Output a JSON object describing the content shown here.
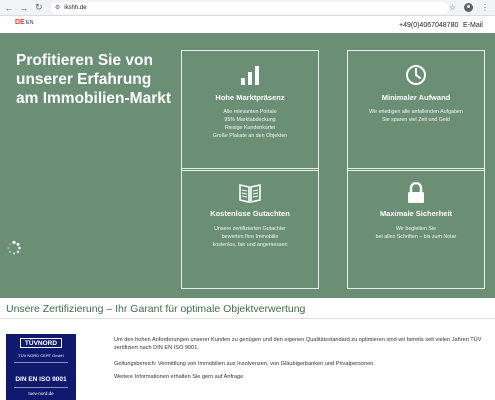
{
  "browser": {
    "url": "ikshh.de"
  },
  "topbar": {
    "lang_de": "DE",
    "lang_en": "EN",
    "phone": "+49(0)4067048780",
    "email": "E-Mail"
  },
  "hero": {
    "title": "Profitieren Sie von unserer Erfahrung am Immobilien-Markt",
    "background_color": "#6b8f75",
    "features": [
      {
        "icon": "bar-chart-icon",
        "title": "Hohe Marktpräsenz",
        "lines": [
          "Alle relevanten Portale",
          "95% Marktabdeckung",
          "Riesige Kundenkartei",
          "Große Plakate an den Objekten"
        ]
      },
      {
        "icon": "clock-icon",
        "title": "Minimaler Aufwand",
        "lines": [
          "Wir erledigen alle anfallenden Aufgaben",
          "Sie sparen viel Zeit und Geld"
        ]
      },
      {
        "icon": "book-icon",
        "title": "Kostenlose Gutachten",
        "lines": [
          "Unsere zertifizierten Gutachter",
          "bewerten Ihre Immobilie",
          "kostenlos, fair und angemessen"
        ]
      },
      {
        "icon": "lock-icon",
        "title": "Maximale Sicherheit",
        "lines": [
          "Wir begleiten Sie",
          "bei allen Schritten – bis zum Notar"
        ]
      }
    ]
  },
  "certification": {
    "heading": "Unsere Zertifizierung – Ihr Garant für optimale Objektverwertung",
    "badge": {
      "logo": "TÜVNORD",
      "cert_label": "TÜV NORD CERT GmbH",
      "standard": "DIN EN ISO 9001",
      "url": "tuev-nord.de"
    },
    "paragraphs": [
      "Um den hohen Anforderungen unserer Kunden zu genügen und den eigenen Qualitätsstandard zu optimieren sind wir bereits seit vielen Jahren TÜV zertifiziert nach DIN EN ISO 9001.",
      "Geltungsbereich: Vermittlung von Immobilien aus Insolvenzen, von Gläubigerbanken und Privatpersonen.",
      "Weitere Informationen erhalten Sie gern auf Anfrage."
    ]
  },
  "colors": {
    "accent_green": "#3f6b4c",
    "lang_active": "#e03a2f",
    "tuv_blue": "#0f1a6e"
  }
}
